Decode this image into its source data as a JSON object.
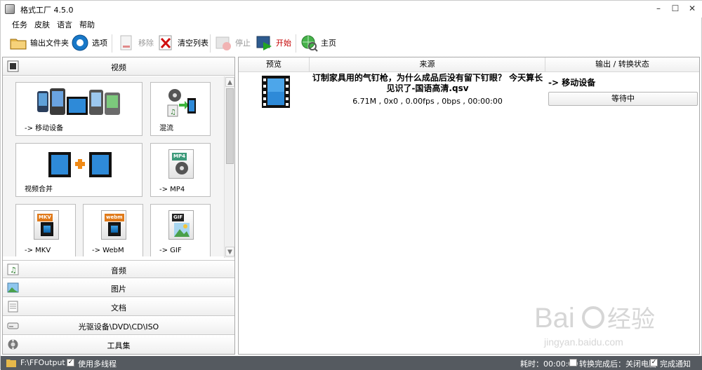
{
  "app": {
    "title": "格式工厂 4.5.0",
    "window_controls": {
      "minimize": "–",
      "maximize": "☐",
      "close": "✕"
    }
  },
  "menu": [
    "任务",
    "皮肤",
    "语言",
    "帮助"
  ],
  "toolbar": {
    "output_folder": "输出文件夹",
    "options": "选项",
    "remove": "移除",
    "clear_list": "清空列表",
    "stop": "停止",
    "start": "开始",
    "home": "主页"
  },
  "categories": {
    "video": "视频",
    "audio": "音频",
    "image": "图片",
    "document": "文档",
    "optical": "光驱设备\\DVD\\CD\\ISO",
    "tools": "工具集"
  },
  "video_tiles": [
    {
      "label": "-> 移动设备",
      "icon": "mobile-devices-icon"
    },
    {
      "label": "混流",
      "icon": "mux-icon"
    },
    {
      "label": "视频合并",
      "icon": "video-join-icon"
    },
    {
      "label": "-> MP4",
      "icon": "mp4-file-icon",
      "tag": "MP4"
    },
    {
      "label": "-> MKV",
      "icon": "mkv-file-icon",
      "tag": "MKV"
    },
    {
      "label": "-> WebM",
      "icon": "webm-file-icon",
      "tag": "webm"
    },
    {
      "label": "-> GIF",
      "icon": "gif-file-icon",
      "tag": "GIF"
    }
  ],
  "columns": {
    "preview": "预览",
    "source": "来源",
    "output_status": "输出 / 转换状态"
  },
  "task": {
    "title": "订制家具用的气钉枪，为什么成品后没有留下钉眼？ 今天算长见识了-国语高清.qsv",
    "info": "6.71M , 0x0 , 0.00fps , 0bps , 00:00:00",
    "destination": "-> 移动设备",
    "status": "等待中"
  },
  "statusbar": {
    "output_path": "F:\\FFOutput",
    "multithread": "使用多线程",
    "multithread_checked": true,
    "elapsed": "耗时：00:00:00",
    "after_convert": "转换完成后：关闭电脑",
    "after_convert_checked": false,
    "notify": "完成通知",
    "notify_checked": true
  },
  "watermark": {
    "brand": "Bai",
    "brand_cn": "经验",
    "url": "jingyan.baidu.com"
  },
  "colors": {
    "statusbar": "#555a60",
    "start_red": "#c40000",
    "accent_blue": "#1878c8"
  }
}
